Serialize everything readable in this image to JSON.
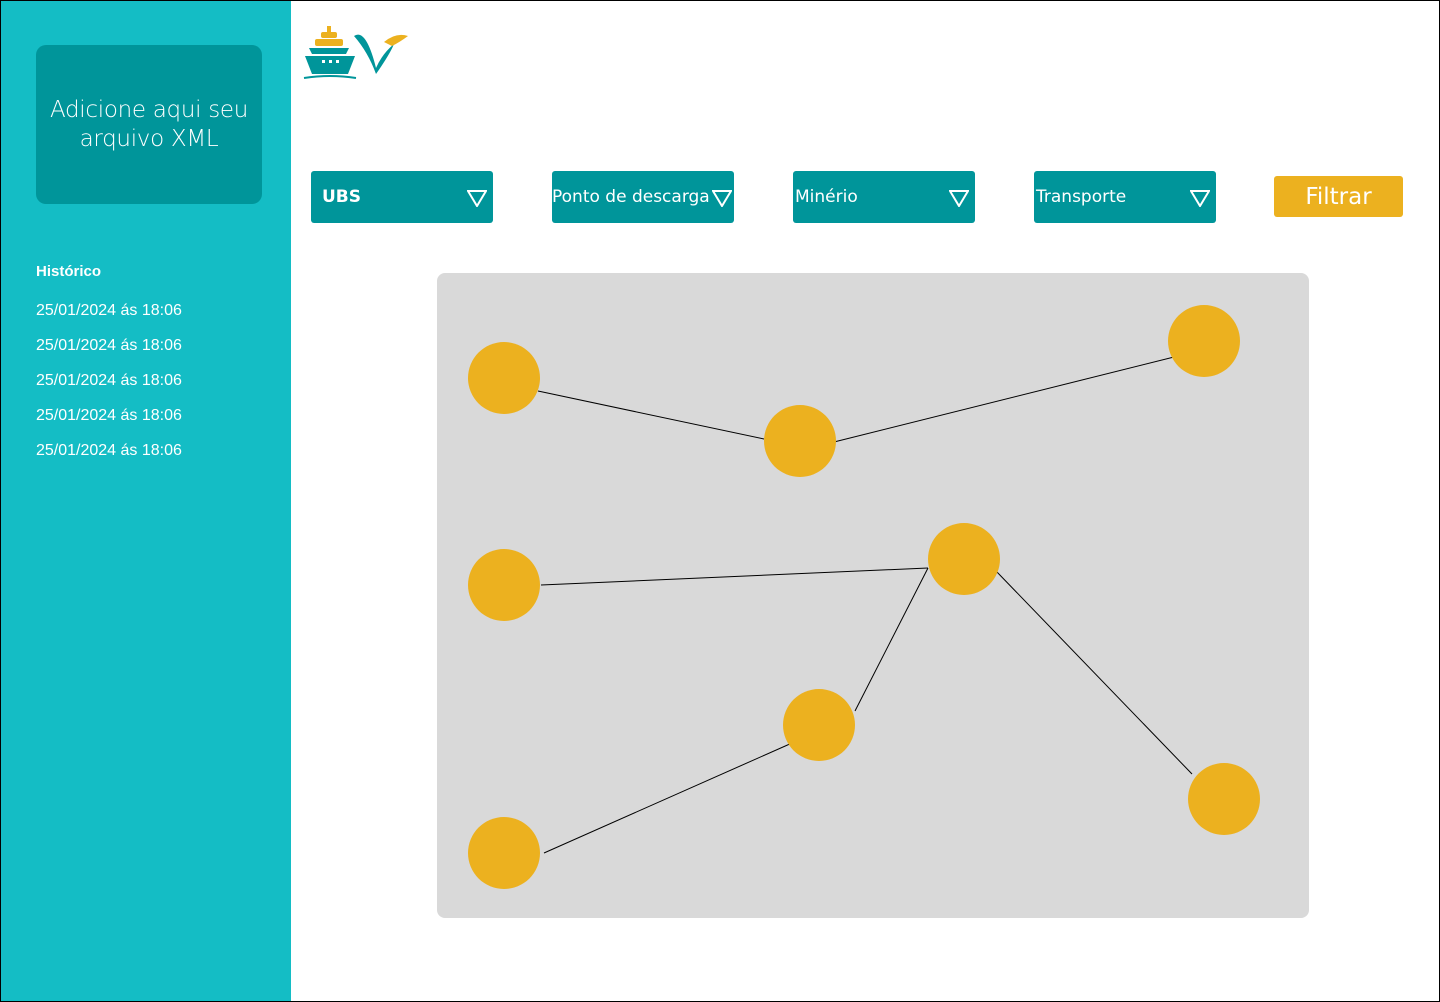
{
  "sidebar": {
    "upload_label": "Adicione aqui seu\narquivo XML",
    "history_title": "Histórico",
    "history": [
      "25/01/2024 ás 18:06",
      "25/01/2024 ás 18:06",
      "25/01/2024 ás 18:06",
      "25/01/2024 ás 18:06",
      "25/01/2024 ás 18:06"
    ]
  },
  "filters": {
    "ubs": "UBS",
    "descarga": "Ponto de descarga",
    "minerio": "Minério",
    "transporte": "Transporte",
    "filter_button": "Filtrar"
  },
  "colors": {
    "sidebar": "#14bdc5",
    "accent_dark": "#00959a",
    "node": "#ecb11f",
    "panel": "#d9d9d9"
  },
  "icons": [
    "ship-icon",
    "vale-logo",
    "chevron-down-icon"
  ]
}
